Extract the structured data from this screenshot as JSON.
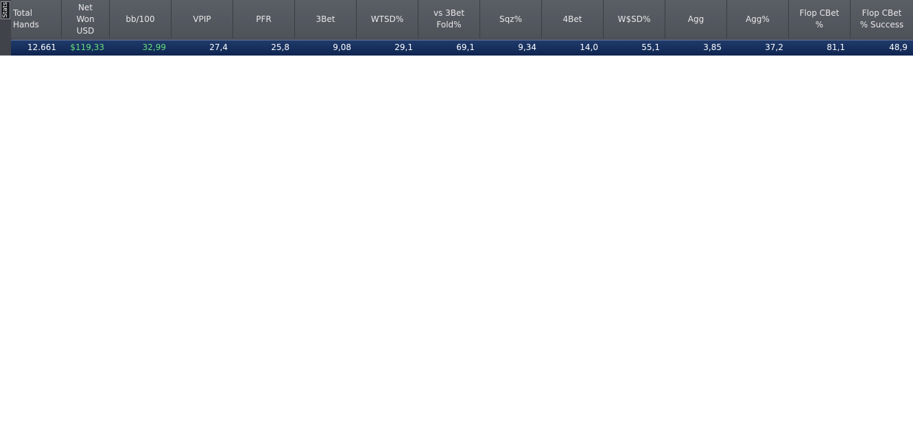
{
  "side_tab": {
    "label": "Stats"
  },
  "columns": [
    {
      "header": "Total\nHands",
      "value": "12.661"
    },
    {
      "header": "Net\nWon\nUSD",
      "value": "$119,33",
      "positive": true
    },
    {
      "header": "bb/100",
      "value": "32,99",
      "positive": true
    },
    {
      "header": "VPIP",
      "value": "27,4"
    },
    {
      "header": "PFR",
      "value": "25,8"
    },
    {
      "header": "3Bet",
      "value": "9,08"
    },
    {
      "header": "WTSD%",
      "value": "29,1"
    },
    {
      "header": "vs 3Bet\nFold%",
      "value": "69,1"
    },
    {
      "header": "Sqz%",
      "value": "9,34"
    },
    {
      "header": "4Bet",
      "value": "14,0"
    },
    {
      "header": "W$SD%",
      "value": "55,1"
    },
    {
      "header": "Agg",
      "value": "3,85"
    },
    {
      "header": "Agg%",
      "value": "37,2"
    },
    {
      "header": "Flop CBet\n%",
      "value": "81,1"
    },
    {
      "header": "Flop CBet\n% Success",
      "value": "48,9"
    }
  ],
  "colors": {
    "positive_value": "#66e07a",
    "row_background": "#0f2550",
    "header_background": "#54585f"
  }
}
